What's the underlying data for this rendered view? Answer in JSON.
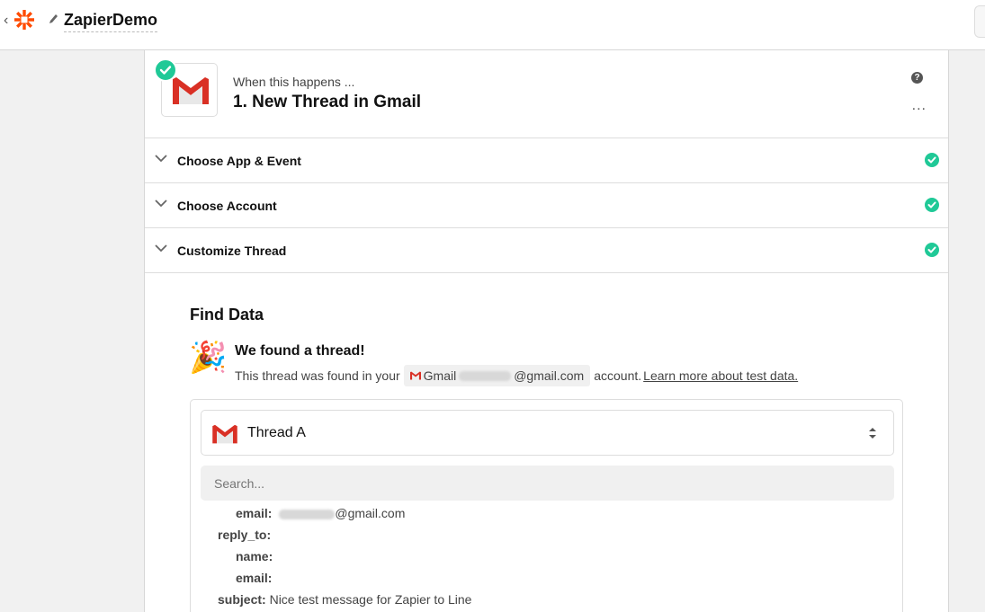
{
  "header": {
    "zap_name": "ZapierDemo"
  },
  "step": {
    "when_text": "When this happens ...",
    "title": "1. New Thread in Gmail",
    "help": "?",
    "more": "..."
  },
  "sections": [
    {
      "label": "Choose App & Event"
    },
    {
      "label": "Choose Account"
    },
    {
      "label": "Customize Thread"
    }
  ],
  "find_data": {
    "title": "Find Data",
    "found_title": "We found a thread!",
    "found_prefix": "This thread was found in your",
    "account_app": "Gmail",
    "account_suffix": "@gmail.com",
    "found_mid": "account.",
    "learn_link": "Learn more about test data."
  },
  "thread": {
    "selected": "Thread A",
    "search_placeholder": "Search..."
  },
  "fields": [
    {
      "key": "email:",
      "value": "@gmail.com"
    },
    {
      "key": "reply_to:",
      "value": ""
    },
    {
      "key": "name:",
      "value": ""
    },
    {
      "key": "email:",
      "value": ""
    },
    {
      "key": "subject:",
      "value": "Nice test message for Zapier to Line"
    }
  ],
  "colors": {
    "success": "#20c997",
    "gmail_red": "#d93025",
    "zapier_red": "#ff4a00"
  }
}
